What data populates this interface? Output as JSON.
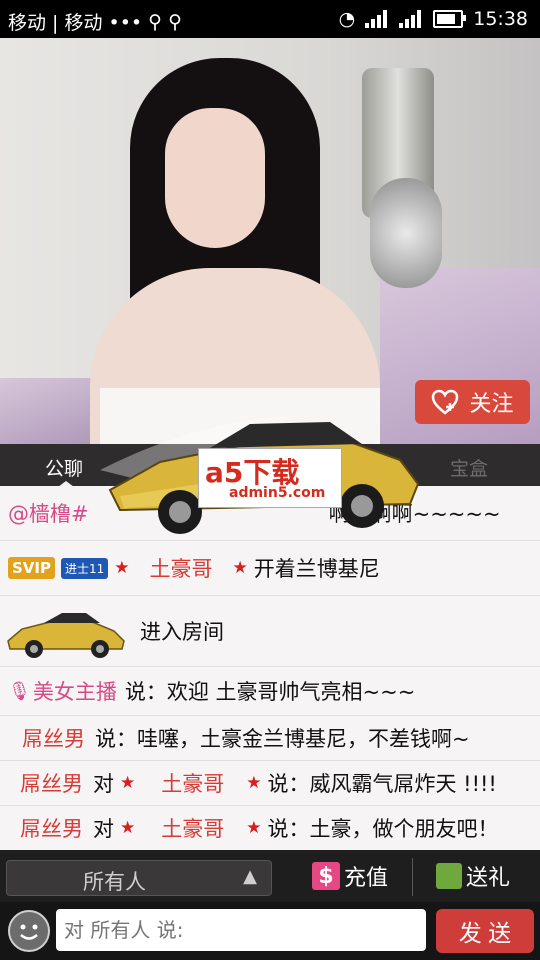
{
  "status_bar": {
    "carrier": "移动 | 移动 •••",
    "time": "15:38"
  },
  "video": {
    "follow_label": "关注"
  },
  "tabs": {
    "public_chat": "公聊",
    "treasure_box": "宝盒"
  },
  "watermark": {
    "brand": "a5下载",
    "site": "admin5.com"
  },
  "chat": {
    "rows": [
      {
        "name": "@樯橹#",
        "message": "啊啊啊啊~~~~~"
      },
      {
        "badge_svip": "SVIP",
        "badge_level": "进士11",
        "name": "土豪哥",
        "message": "开着兰博基尼"
      },
      {
        "message": "进入房间"
      },
      {
        "name": "美女主播",
        "verb": "说：",
        "message": "欢迎 土豪哥帅气亮相~~~"
      },
      {
        "name": "屌丝男",
        "verb": "说：",
        "message": "哇噻，土豪金兰博基尼，不差钱啊~"
      },
      {
        "name": "屌丝男",
        "verb": "对",
        "target": "土豪哥",
        "verb2": "说：",
        "message": "威风霸气屌炸天 !!!!"
      },
      {
        "name": "屌丝男",
        "verb": "对",
        "target": "土豪哥",
        "verb2": "说：",
        "message": "土豪，做个朋友吧！"
      }
    ]
  },
  "bottom_bar": {
    "recipient": "所有人",
    "recharge_label": "充值",
    "gift_label": "送礼"
  },
  "input_bar": {
    "placeholder": "对 所有人 说:",
    "send_label": "发 送"
  },
  "colors": {
    "accent_red": "#d9493b",
    "gift_green": "#6fa83c",
    "recharge_pink": "#e54883"
  }
}
